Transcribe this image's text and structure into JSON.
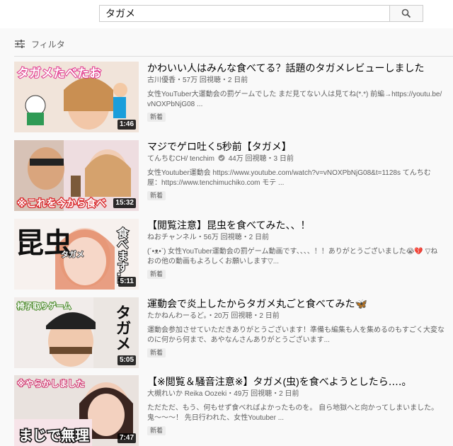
{
  "search": {
    "value": "タガメ"
  },
  "filter": {
    "label": "フィルタ"
  },
  "colors": {
    "badge_bg": "#ececec",
    "text_secondary": "#606060"
  },
  "results": [
    {
      "title": "かわいい人はみんな食べてる？話題のタガメレビューしました",
      "channel": "古川優香・57万 回視聴・2 日前",
      "description": "女性YouTuber大運動会の罰ゲームでした まだ見てない人は見てね(*.*) 前編→https://youtu.be/vNOXPbNjG08 ...",
      "badge": "新着",
      "duration": "1:46",
      "thumb_text": "タガメたべたお"
    },
    {
      "title": "マジでゲロ吐く5秒前【タガメ】",
      "channel_name": "てんちむCH/ tenchim",
      "channel_rest": "44万 回視聴・3 日前",
      "description": "女性Youtuber運動会 https://www.youtube.com/watch?v=vNOXPbNjG08&t=1128s てんちむ屋：https://www.tenchimuchiko.com モテ ...",
      "badge": "新着",
      "duration": "15:32",
      "thumb_text": "※これを今から食べ"
    },
    {
      "title": "【閲覧注意】昆虫を食べてみた、、！",
      "channel": "ねおチャンネル・56万 回視聴・2 日前",
      "description": "(´•ᴥ•`) 女性YouTuber運動会の罰ゲーム動画です、、、、！！ありがとうございました😭💔 ▽ねおの他の動画もよろしくお願いします▽...",
      "badge": "新着",
      "duration": "5:11",
      "thumb_text_big": "昆虫",
      "thumb_text_side": "食べます…",
      "thumb_text_small": "タガメ"
    },
    {
      "title": "運動会で炎上したからタガメ丸ごと食べてみた🦋",
      "channel": "たかねんわーるど。・20万 回視聴・2 日前",
      "description": "運動会参加させていただきありがとうございます！準備も編集も人を集めるのもすごく大変なのに何から何まで、あやなんさんありがとうございます...",
      "badge": "新着",
      "duration": "5:05",
      "thumb_text": "椅子取りゲーム",
      "thumb_text_side": "タガメ"
    },
    {
      "title": "【※閲覧＆騒音注意※】タガメ(虫)を食べようとしたら‥‥。",
      "channel": "大槻れいか Reika Oozeki・49万 回視聴・2 日前",
      "description": "ただただ、もう、何もせず食べればよかったものを。 自ら地獄へと向かってしまいました。 鬼〜〜〜！ 先日行われた、女性Youtuber ...",
      "badge": "新着",
      "duration": "7:47",
      "thumb_text": "※やらかしました",
      "thumb_text_big": "まじで無理"
    }
  ]
}
